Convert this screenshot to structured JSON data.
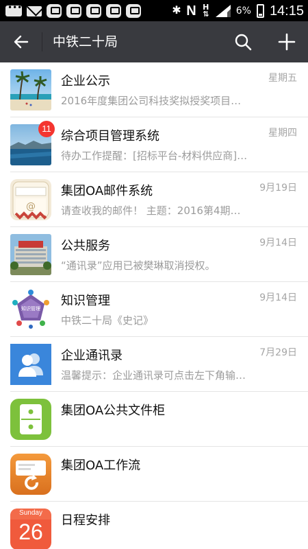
{
  "status_bar": {
    "battery_percent": "6%",
    "time": "14:15",
    "network_h": "H",
    "n_label": "N"
  },
  "header": {
    "title": "中铁二十局"
  },
  "conversations": [
    {
      "name": "企业公示",
      "time": "星期五",
      "preview": "2016年度集团公司科技奖拟授奖项目…"
    },
    {
      "name": "综合项目管理系统",
      "time": "星期四",
      "preview": "待办工作提醒：[招标平台-材料供应商]…",
      "badge": "11"
    },
    {
      "name": "集团OA邮件系统",
      "time": "9月19日",
      "preview": "请查收我的邮件！ 主题：2016第4期…"
    },
    {
      "name": "公共服务",
      "time": "9月14日",
      "preview": "“通讯录”应用已被樊琳取消授权。"
    },
    {
      "name": "知识管理",
      "time": "9月14日",
      "preview": "中铁二十局《史记》"
    },
    {
      "name": "企业通讯录",
      "time": "7月29日",
      "preview": "温馨提示：企业通讯录可点击左下角输…"
    },
    {
      "name": "集团OA公共文件柜",
      "time": "",
      "preview": ""
    },
    {
      "name": "集团OA工作流",
      "time": "",
      "preview": ""
    },
    {
      "name": "日程安排",
      "time": "",
      "preview": ""
    }
  ],
  "icons": {
    "knowledge_center": "知识管理",
    "calendar_weekday": "Sunday",
    "calendar_day": "26"
  },
  "colors": {
    "appbar": "#393a3f",
    "badge": "#f43530",
    "contacts_blue": "#3a86db",
    "cabinet_green": "#7dc13c",
    "workflow_orange": "#e8822e",
    "calendar_red": "#f05a3c"
  }
}
